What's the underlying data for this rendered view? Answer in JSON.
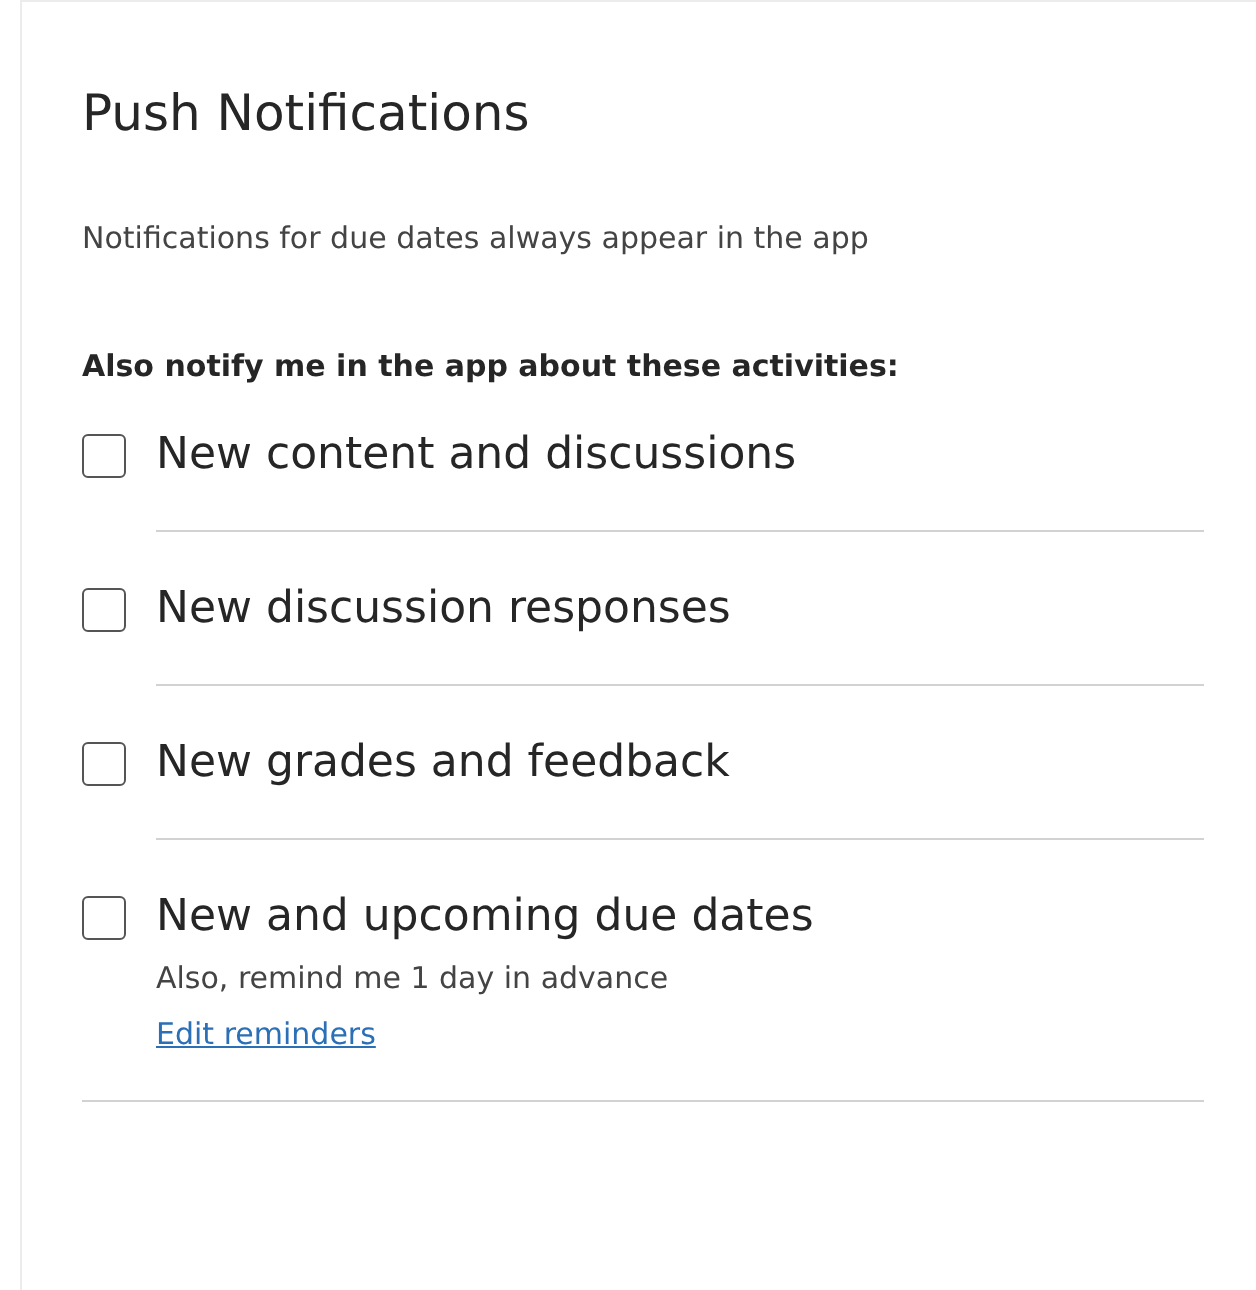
{
  "title": "Push Notifications",
  "description": "Notifications for due dates always appear in the app",
  "prompt": "Also notify me in the app about these activities:",
  "options": [
    {
      "label": "New content and discussions",
      "checked": false
    },
    {
      "label": "New discussion responses",
      "checked": false
    },
    {
      "label": "New grades and feedback",
      "checked": false
    },
    {
      "label": "New and upcoming due dates",
      "checked": false,
      "note": "Also, remind me 1 day in advance",
      "link": "Edit reminders"
    }
  ]
}
